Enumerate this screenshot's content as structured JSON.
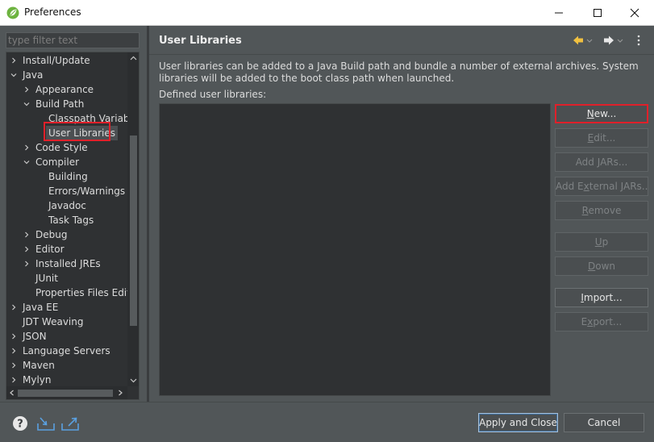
{
  "window": {
    "title": "Preferences",
    "icon": "spring-leaf-icon",
    "controls": [
      "minimize-icon",
      "maximize-icon",
      "close-icon"
    ]
  },
  "filter": {
    "placeholder": "type filter text",
    "value": ""
  },
  "tree": {
    "items": [
      {
        "label": "Install/Update",
        "depth": 0,
        "expander": "collapsed"
      },
      {
        "label": "Java",
        "depth": 0,
        "expander": "expanded"
      },
      {
        "label": "Appearance",
        "depth": 1,
        "expander": "collapsed"
      },
      {
        "label": "Build Path",
        "depth": 1,
        "expander": "expanded"
      },
      {
        "label": "Classpath Variable",
        "depth": 2,
        "expander": "none"
      },
      {
        "label": "User Libraries",
        "depth": 2,
        "expander": "none",
        "selected": true
      },
      {
        "label": "Code Style",
        "depth": 1,
        "expander": "collapsed"
      },
      {
        "label": "Compiler",
        "depth": 1,
        "expander": "expanded"
      },
      {
        "label": "Building",
        "depth": 2,
        "expander": "none"
      },
      {
        "label": "Errors/Warnings",
        "depth": 2,
        "expander": "none"
      },
      {
        "label": "Javadoc",
        "depth": 2,
        "expander": "none"
      },
      {
        "label": "Task Tags",
        "depth": 2,
        "expander": "none"
      },
      {
        "label": "Debug",
        "depth": 1,
        "expander": "collapsed"
      },
      {
        "label": "Editor",
        "depth": 1,
        "expander": "collapsed"
      },
      {
        "label": "Installed JREs",
        "depth": 1,
        "expander": "collapsed"
      },
      {
        "label": "JUnit",
        "depth": 1,
        "expander": "none"
      },
      {
        "label": "Properties Files Edito",
        "depth": 1,
        "expander": "none"
      },
      {
        "label": "Java EE",
        "depth": 0,
        "expander": "collapsed"
      },
      {
        "label": "JDT Weaving",
        "depth": 0,
        "expander": "none"
      },
      {
        "label": "JSON",
        "depth": 0,
        "expander": "collapsed"
      },
      {
        "label": "Language Servers",
        "depth": 0,
        "expander": "collapsed"
      },
      {
        "label": "Maven",
        "depth": 0,
        "expander": "collapsed"
      },
      {
        "label": "Mylyn",
        "depth": 0,
        "expander": "collapsed"
      }
    ]
  },
  "page": {
    "title": "User Libraries",
    "description": "User libraries can be added to a Java Build path and bundle a number of external archives. System libraries will be added to the boot class path when launched.",
    "list_label": "Defined user libraries:",
    "nav_icons": [
      "back-arrow-icon",
      "forward-arrow-icon",
      "view-menu-icon"
    ],
    "buttons": {
      "new": {
        "pre": "",
        "mnemonic": "N",
        "post": "ew..."
      },
      "edit": {
        "pre": "",
        "mnemonic": "E",
        "post": "dit..."
      },
      "add_jars": {
        "pre": "Add ",
        "mnemonic": "J",
        "post": "ARs..."
      },
      "add_external_jars": {
        "pre": "Add E",
        "mnemonic": "x",
        "post": "ternal JARs..."
      },
      "remove": {
        "pre": "",
        "mnemonic": "R",
        "post": "emove"
      },
      "up": {
        "pre": "",
        "mnemonic": "U",
        "post": "p"
      },
      "down": {
        "pre": "",
        "mnemonic": "D",
        "post": "own"
      },
      "import": {
        "pre": "",
        "mnemonic": "I",
        "post": "mport..."
      },
      "export": {
        "pre": "E",
        "mnemonic": "x",
        "post": "port..."
      }
    }
  },
  "bottom": {
    "icons": [
      "help-icon",
      "import-preferences-icon",
      "export-preferences-icon"
    ],
    "apply_close": "Apply and Close",
    "cancel": "Cancel"
  }
}
